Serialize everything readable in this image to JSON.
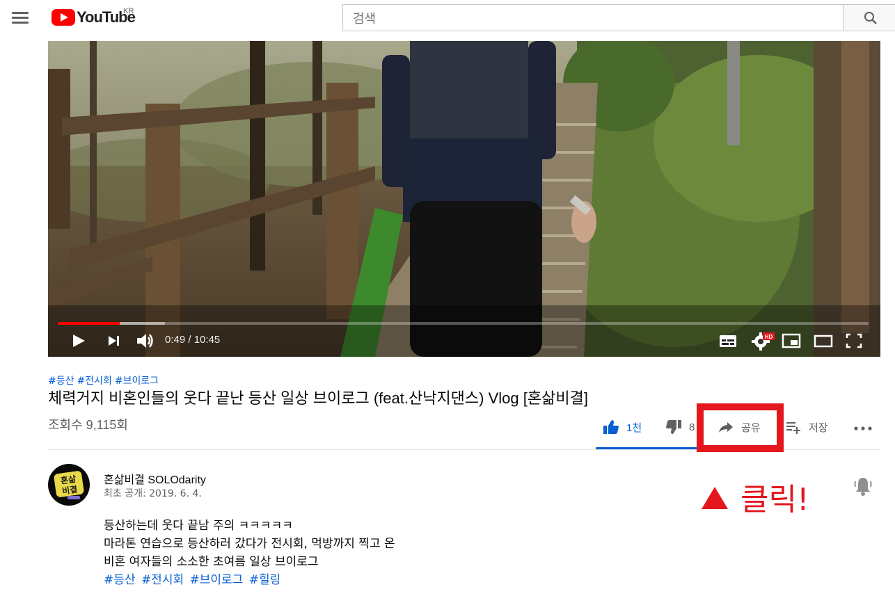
{
  "header": {
    "logo_text": "YouTube",
    "country_code": "KR",
    "search_placeholder": "검색"
  },
  "player": {
    "time_current": "0:49",
    "time_separator": " / ",
    "time_total": "10:45",
    "progress_fraction": 0.076,
    "buffer_fraction": 0.132,
    "hd_badge": "HD"
  },
  "video": {
    "tags": [
      "#등산",
      "#전시회",
      "#브이로그"
    ],
    "title": "체력거지 비혼인들의 웃다 끝난 등산 일상 브이로그 (feat.산낙지댄스) Vlog [혼삶비결]",
    "views": "조회수 9,115회"
  },
  "actions": {
    "like_count": "1천",
    "dislike_count": "8",
    "share_label": "공유",
    "save_label": "저장"
  },
  "channel": {
    "name": "혼삶비결 SOLOdarity",
    "published": "최초 공개: 2019. 6. 4.",
    "avatar_text_1": "혼삶",
    "avatar_text_2": "비결"
  },
  "annotation": {
    "text": "클릭!",
    "color": "#e3171d"
  },
  "description": {
    "lines": [
      "등산하는데 웃다 끝남 주의 ㅋㅋㅋㅋㅋ",
      "마라톤 연습으로 등산하러 갔다가 전시회, 먹방까지 찍고 온",
      "비혼 여자들의 소소한 초여름 일상 브이로그"
    ],
    "hashtags": [
      "#등산",
      "#전시회",
      "#브이로그",
      "#힐링"
    ]
  },
  "colors": {
    "accent_blue": "#065fd4",
    "youtube_red": "#ff0000"
  }
}
